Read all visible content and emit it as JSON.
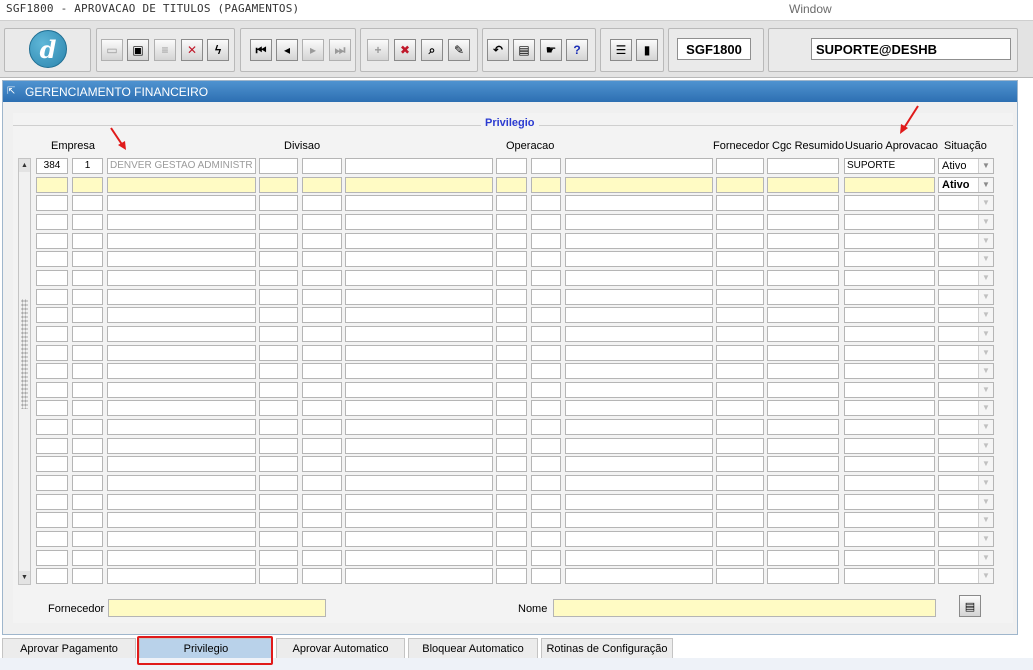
{
  "app": {
    "title": "SGF1800 - APROVACAO DE TITULOS (PAGAMENTOS)",
    "window_menu": "Window"
  },
  "toolbar": {
    "logo_letter": "d",
    "form_code": "SGF1800",
    "user_db": "SUPORTE@DESHB",
    "buttons": [
      {
        "name": "save-button",
        "glyph": "▭",
        "enabled": false
      },
      {
        "name": "print-preview-button",
        "glyph": "▣",
        "enabled": true
      },
      {
        "name": "print-button",
        "glyph": "≡",
        "enabled": false
      },
      {
        "name": "exit-button",
        "glyph": "✕",
        "enabled": true
      },
      {
        "name": "execute-button",
        "glyph": "ϟ",
        "enabled": true
      },
      {
        "name": "first-record-button",
        "glyph": "⏮",
        "enabled": true
      },
      {
        "name": "previous-record-button",
        "glyph": "◂",
        "enabled": true
      },
      {
        "name": "next-record-button",
        "glyph": "▸",
        "enabled": false
      },
      {
        "name": "last-record-button",
        "glyph": "⏭",
        "enabled": false
      },
      {
        "name": "insert-record-button",
        "glyph": "+",
        "enabled": false
      },
      {
        "name": "delete-record-button",
        "glyph": "✖",
        "enabled": true
      },
      {
        "name": "enter-query-button",
        "glyph": "⌕",
        "enabled": true
      },
      {
        "name": "clear-button",
        "glyph": "✎",
        "enabled": true
      },
      {
        "name": "undo-button",
        "glyph": "↶",
        "enabled": true
      },
      {
        "name": "clipboard-button",
        "glyph": "▤",
        "enabled": true
      },
      {
        "name": "help-hand-button",
        "glyph": "☛",
        "enabled": true
      },
      {
        "name": "help-button",
        "glyph": "?",
        "enabled": true
      },
      {
        "name": "menu-button",
        "glyph": "☰",
        "enabled": true
      },
      {
        "name": "exit-door-button",
        "glyph": "▮",
        "enabled": true
      }
    ]
  },
  "window": {
    "title": "GERENCIAMENTO FINANCEIRO",
    "section_title": "Privilegio"
  },
  "grid": {
    "headers": {
      "empresa": "Empresa",
      "divisao": "Divisao",
      "operacao": "Operacao",
      "fornecedor": "Fornecedor",
      "cgc": "Cgc Resumido",
      "usuario": "Usuario Aprovacao",
      "situacao": "Situação"
    },
    "row1": {
      "empresa": "384",
      "empresa2": "1",
      "empresa_nome": "DENVER GESTAO ADMINISTR",
      "usuario": "SUPORTE",
      "situacao": "Ativo"
    },
    "row2": {
      "situacao": "Ativo"
    },
    "empty_rows": 21
  },
  "footer": {
    "fornecedor_label": "Fornecedor",
    "nome_label": "Nome"
  },
  "tabs": [
    {
      "label": "Aprovar Pagamento"
    },
    {
      "label": "Privilegio"
    },
    {
      "label": "Aprovar Automatico"
    },
    {
      "label": "Bloquear Automatico"
    },
    {
      "label": "Rotinas de Configuração"
    }
  ],
  "colors": {
    "window_header": "#2d6fb2",
    "active_row": "#fffbc4",
    "highlight_annotation": "#e01a1a",
    "section_title": "#2b3bd1"
  }
}
